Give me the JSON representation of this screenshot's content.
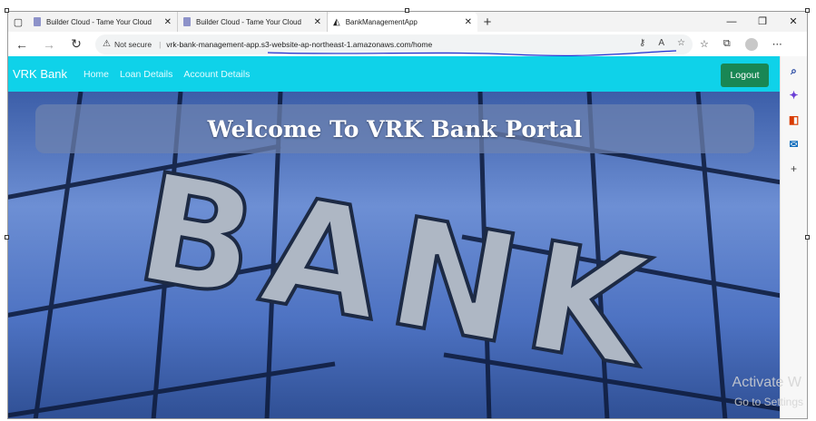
{
  "browser": {
    "tabs": [
      {
        "title": "Builder Cloud - Tame Your Cloud",
        "active": false
      },
      {
        "title": "Builder Cloud - Tame Your Cloud",
        "active": false
      },
      {
        "title": "BankManagementApp",
        "active": true
      }
    ],
    "address": {
      "security_label": "Not secure",
      "url": "vrk-bank-management-app.s3-website-ap-northeast-1.amazonaws.com/home"
    }
  },
  "app": {
    "brand": "VRK Bank",
    "nav_links": [
      "Home",
      "Loan Details",
      "Account Details"
    ],
    "logout_label": "Logout",
    "hero_title": "Welcome To VRK Bank Portal",
    "hero_image_text": "BANK"
  },
  "os": {
    "watermark_line1": "Activate W",
    "watermark_line2": "Go to Settings"
  },
  "colors": {
    "navbar": "#0fd2e9",
    "logout_button": "#198754"
  }
}
